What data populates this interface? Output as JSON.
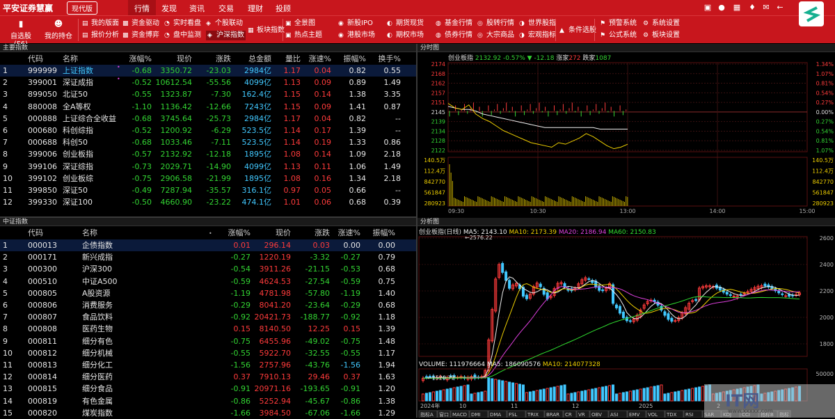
{
  "titlebar": {
    "logo": "平安证券慧赢",
    "version": "现代版",
    "tabs": [
      "行情",
      "发现",
      "资讯",
      "交易",
      "理财",
      "投顾"
    ],
    "active_tab": "行情"
  },
  "toolbar": {
    "big": [
      {
        "label": "自选股(F6)",
        "icon": "bookmark-icon"
      },
      {
        "label": "我的持仓",
        "icon": "user-icon"
      }
    ],
    "small": [
      [
        "我的版面",
        "报价分析"
      ],
      [
        "资金驱动",
        "资金博弈"
      ],
      [
        "实时看盘",
        "盘中监测"
      ],
      [
        "个股联动",
        "沪深指数"
      ],
      [
        "板块指数"
      ],
      [
        "全景图",
        "热点主题"
      ],
      [
        "新股IPO",
        "港股市场"
      ],
      [
        "期货现货",
        "期权市场"
      ],
      [
        "基金行情",
        "债券行情"
      ],
      [
        "股转行情",
        "大宗商品"
      ],
      [
        "世界股指",
        "宏观指标"
      ],
      [
        "条件选股"
      ],
      [
        "预警系统",
        "公式系统"
      ],
      [
        "系统设置",
        "板块设置"
      ]
    ],
    "highlighted": "沪深指数"
  },
  "main_index": {
    "title": "主要指数",
    "headers": [
      "",
      "代码",
      "名称",
      "涨幅%",
      "现价",
      "涨跌",
      "总金额",
      "量比",
      "涨速%",
      "振幅%",
      "换手%"
    ],
    "rows": [
      [
        "1",
        "999999",
        "上证指数",
        "-0.68",
        "3350.72",
        "-23.03",
        "2984亿",
        "1.17",
        "0.04",
        "0.82",
        "0.55"
      ],
      [
        "2",
        "399001",
        "深证成指",
        "-0.52",
        "10612.54",
        "-55.56",
        "4099亿",
        "1.13",
        "0.09",
        "0.89",
        "1.49"
      ],
      [
        "3",
        "899050",
        "北证50",
        "-0.55",
        "1323.87",
        "-7.30",
        "162.4亿",
        "1.15",
        "0.14",
        "1.38",
        "3.35"
      ],
      [
        "4",
        "880008",
        "全A等权",
        "-1.10",
        "1136.42",
        "-12.66",
        "7243亿",
        "1.15",
        "0.09",
        "1.41",
        "0.87"
      ],
      [
        "5",
        "000888",
        "上证综合全收益",
        "-0.68",
        "3745.64",
        "-25.73",
        "2984亿",
        "1.17",
        "0.04",
        "0.82",
        "--"
      ],
      [
        "6",
        "000680",
        "科创综指",
        "-0.52",
        "1200.92",
        "-6.29",
        "523.5亿",
        "1.14",
        "0.17",
        "1.39",
        "--"
      ],
      [
        "7",
        "000688",
        "科创50",
        "-0.68",
        "1033.46",
        "-7.11",
        "523.5亿",
        "1.14",
        "0.19",
        "1.33",
        "0.86"
      ],
      [
        "8",
        "399006",
        "创业板指",
        "-0.57",
        "2132.92",
        "-12.18",
        "1895亿",
        "1.08",
        "0.14",
        "1.09",
        "2.18"
      ],
      [
        "9",
        "399106",
        "深证综指",
        "-0.73",
        "2029.71",
        "-14.90",
        "4099亿",
        "1.13",
        "0.11",
        "1.06",
        "1.49"
      ],
      [
        "10",
        "399102",
        "创业板综",
        "-0.75",
        "2906.58",
        "-21.99",
        "1895亿",
        "1.08",
        "0.16",
        "1.34",
        "2.18"
      ],
      [
        "11",
        "399850",
        "深证50",
        "-0.49",
        "7287.94",
        "-35.57",
        "316.1亿",
        "0.97",
        "0.05",
        "0.66",
        "--"
      ],
      [
        "12",
        "399330",
        "深证100",
        "-0.50",
        "4660.90",
        "-23.22",
        "474.1亿",
        "1.01",
        "0.06",
        "0.68",
        "0.39"
      ]
    ]
  },
  "csi_index": {
    "title": "中证指数",
    "headers": [
      "",
      "代码",
      "名称",
      "涨幅%",
      "现价",
      "涨跌",
      "涨速%",
      "振幅%"
    ],
    "rows": [
      [
        "1",
        "000013",
        "企债指数",
        "0.01",
        "296.14",
        "0.03",
        "0.00",
        "0.00"
      ],
      [
        "2",
        "000171",
        "新兴成指",
        "-0.27",
        "1220.19",
        "-3.32",
        "-0.27",
        "0.79"
      ],
      [
        "3",
        "000300",
        "沪深300",
        "-0.54",
        "3911.26",
        "-21.15",
        "-0.53",
        "0.68"
      ],
      [
        "4",
        "000510",
        "中证A500",
        "-0.59",
        "4624.53",
        "-27.54",
        "-0.59",
        "0.75"
      ],
      [
        "5",
        "000805",
        "A股资源",
        "-1.19",
        "4781.98",
        "-57.80",
        "-1.19",
        "1.40"
      ],
      [
        "6",
        "000806",
        "消费服务",
        "-0.29",
        "8041.20",
        "-23.64",
        "-0.29",
        "0.68"
      ],
      [
        "7",
        "000807",
        "食品饮料",
        "-0.92",
        "20421.73",
        "-188.77",
        "-0.92",
        "1.18"
      ],
      [
        "8",
        "000808",
        "医药生物",
        "0.15",
        "8140.50",
        "12.25",
        "0.15",
        "1.39"
      ],
      [
        "9",
        "000811",
        "细分有色",
        "-0.75",
        "6455.96",
        "-49.02",
        "-0.75",
        "1.48"
      ],
      [
        "10",
        "000812",
        "细分机械",
        "-0.55",
        "5922.70",
        "-32.55",
        "-0.55",
        "1.17"
      ],
      [
        "11",
        "000813",
        "细分化工",
        "-1.56",
        "2757.96",
        "-43.76",
        "-1.56",
        "1.94"
      ],
      [
        "12",
        "000814",
        "细分医药",
        "0.37",
        "7910.13",
        "29.46",
        "0.37",
        "1.63"
      ],
      [
        "13",
        "000815",
        "细分食品",
        "-0.91",
        "20971.16",
        "-193.65",
        "-0.91",
        "1.20"
      ],
      [
        "14",
        "000819",
        "有色金属",
        "-0.86",
        "5252.94",
        "-45.67",
        "-0.86",
        "1.38"
      ],
      [
        "15",
        "000820",
        "煤炭指数",
        "-1.66",
        "3984.50",
        "-67.06",
        "-1.66",
        "1.29"
      ]
    ]
  },
  "intraday": {
    "panel_title": "分时图",
    "name": "创业板指",
    "price": "2132.92",
    "pct": "-0.57%",
    "chg": "▼ -12.18",
    "up_label": "涨家",
    "up_count": "272",
    "down_label": "跌家",
    "down_count": "1087",
    "yticks_left": [
      "2174",
      "2168",
      "2162",
      "2157",
      "2151",
      "2145",
      "2139",
      "2134",
      "2128",
      "2122"
    ],
    "yticks_right": [
      "1.34%",
      "1.07%",
      "0.81%",
      "0.54%",
      "0.27%",
      "0.00%",
      "0.27%",
      "0.54%",
      "0.81%",
      "1.07%"
    ],
    "vol_ticks": [
      "140.5万",
      "112.4万",
      "842770",
      "561847",
      "280923"
    ],
    "xticks": [
      "09:30",
      "10:30",
      "13:00",
      "14:00",
      "15:00"
    ],
    "base": 2145,
    "ymin": 2118,
    "ymax": 2177,
    "price_series": [
      2150,
      2147,
      2146,
      2149,
      2143,
      2140,
      2138,
      2135,
      2132,
      2130,
      2128,
      2126,
      2124,
      2123,
      2122,
      2121,
      2124,
      2123,
      2125,
      2127,
      2130,
      2128,
      2125,
      2122,
      2120,
      2121,
      2123
    ],
    "avg_series": [
      2148,
      2147,
      2146,
      2146,
      2145,
      2143,
      2142,
      2141,
      2140,
      2139,
      2138,
      2137,
      2136,
      2135,
      2134,
      2134,
      2134,
      2134,
      2134,
      2134,
      2134,
      2134,
      2133,
      2133,
      2133,
      2133,
      2133
    ]
  },
  "kline": {
    "panel_title": "分析图",
    "name": "创业板指(日线)",
    "ma_labels": [
      {
        "t": "MA5: 2143.10",
        "c": "#f0f0f0"
      },
      {
        "t": "MA10: 2173.39",
        "c": "#f0d000"
      },
      {
        "t": "MA20: 2186.94",
        "c": "#e040e0"
      },
      {
        "t": "MA60: 2150.83",
        "c": "#30e030"
      }
    ],
    "yticks": [
      "2600",
      "2400",
      "2200",
      "2000",
      "1800"
    ],
    "high_label": "2576.22",
    "low_label": "1520.72",
    "vol_labels": [
      {
        "t": "VOLUME: 111976664",
        "c": "#f0f0f0"
      },
      {
        "t": "MA5: 186090576",
        "c": "#f0f0f0"
      },
      {
        "t": "MA10: 214077328",
        "c": "#f0d000"
      }
    ],
    "bottom_tabs": [
      "指标A",
      "窗口",
      "MACD",
      "DMI",
      "DMA",
      "FSL",
      "TRIX",
      "BRAR",
      "CR",
      "VR",
      "OBV",
      "ASI",
      "EMV",
      "VOL",
      "TDX",
      "RSI",
      "SAR",
      "KDJ",
      "CCI",
      "指标B",
      "指标"
    ],
    "date_labels": [
      "2024年",
      "10",
      "11",
      "12",
      "2025",
      "2"
    ]
  },
  "watermark": {
    "text": "IT网",
    "sub": "www.xxxxx.com"
  }
}
